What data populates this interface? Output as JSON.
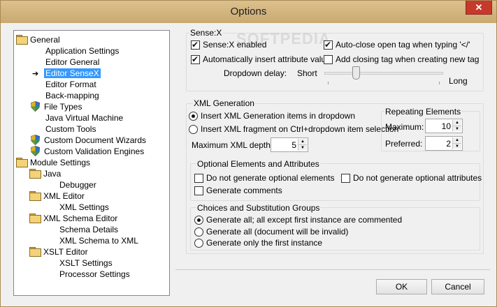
{
  "window": {
    "title": "Options",
    "close_symbol": "✕"
  },
  "tree": {
    "items": [
      {
        "label": "General",
        "icon": "folder-open-icon"
      },
      {
        "label": "Application Settings"
      },
      {
        "label": "Editor General"
      },
      {
        "label": "Editor SenseX",
        "selected": true,
        "marker": "arrow-icon"
      },
      {
        "label": "Editor Format"
      },
      {
        "label": "Back-mapping"
      },
      {
        "label": "File Types",
        "icon": "shield-icon"
      },
      {
        "label": "Java Virtual Machine"
      },
      {
        "label": "Custom Tools"
      },
      {
        "label": "Custom Document Wizards",
        "icon": "shield-icon"
      },
      {
        "label": "Custom Validation Engines",
        "icon": "shield-icon"
      },
      {
        "label": "Module Settings",
        "icon": "folder-open-icon"
      },
      {
        "label": "Java",
        "icon": "folder-open-icon"
      },
      {
        "label": "Debugger"
      },
      {
        "label": "XML Editor",
        "icon": "folder-open-icon"
      },
      {
        "label": "XML Settings"
      },
      {
        "label": "XML Schema Editor",
        "icon": "folder-open-icon"
      },
      {
        "label": "Schema Details"
      },
      {
        "label": "XML Schema to XML"
      },
      {
        "label": "XSLT Editor",
        "icon": "folder-open-icon"
      },
      {
        "label": "XSLT Settings"
      },
      {
        "label": "Processor Settings"
      }
    ]
  },
  "sensex": {
    "group_label": "Sense:X",
    "enabled_label": "Sense:X enabled",
    "enabled_checked": true,
    "auto_insert_label": "Automatically insert attribute value",
    "auto_insert_checked": true,
    "auto_close_label": "Auto-close open tag when typing '</'",
    "auto_close_checked": true,
    "add_closing_label": "Add closing tag when creating new tag",
    "add_closing_checked": false,
    "dropdown_delay_label": "Dropdown delay:",
    "short_label": "Short",
    "long_label": "Long",
    "dropdown_delay_fraction": 0.25
  },
  "xmlgen": {
    "group_label": "XML Generation",
    "insert_items_label": "Insert XML Generation items in dropdown",
    "insert_items_checked": true,
    "insert_fragment_label": "Insert XML fragment on Ctrl+dropdown item selection",
    "insert_fragment_checked": false,
    "max_depth_label": "Maximum XML depth:",
    "max_depth_value": "5",
    "repeating": {
      "group_label": "Repeating Elements",
      "maximum_label": "Maximum:",
      "maximum_value": "10",
      "preferred_label": "Preferred:",
      "preferred_value": "2"
    },
    "optional": {
      "group_label": "Optional Elements and Attributes",
      "no_elements_label": "Do not generate optional elements",
      "no_attributes_label": "Do not generate optional attributes",
      "comments_label": "Generate comments"
    },
    "choices": {
      "group_label": "Choices and Substitution Groups",
      "opt1_label": "Generate all; all except first instance are commented",
      "opt2_label": "Generate all (document will be invalid)",
      "opt3_label": "Generate only the first instance",
      "selected": 1
    }
  },
  "buttons": {
    "ok_label": "OK",
    "cancel_label": "Cancel"
  },
  "watermark": "SOFTPEDIA"
}
